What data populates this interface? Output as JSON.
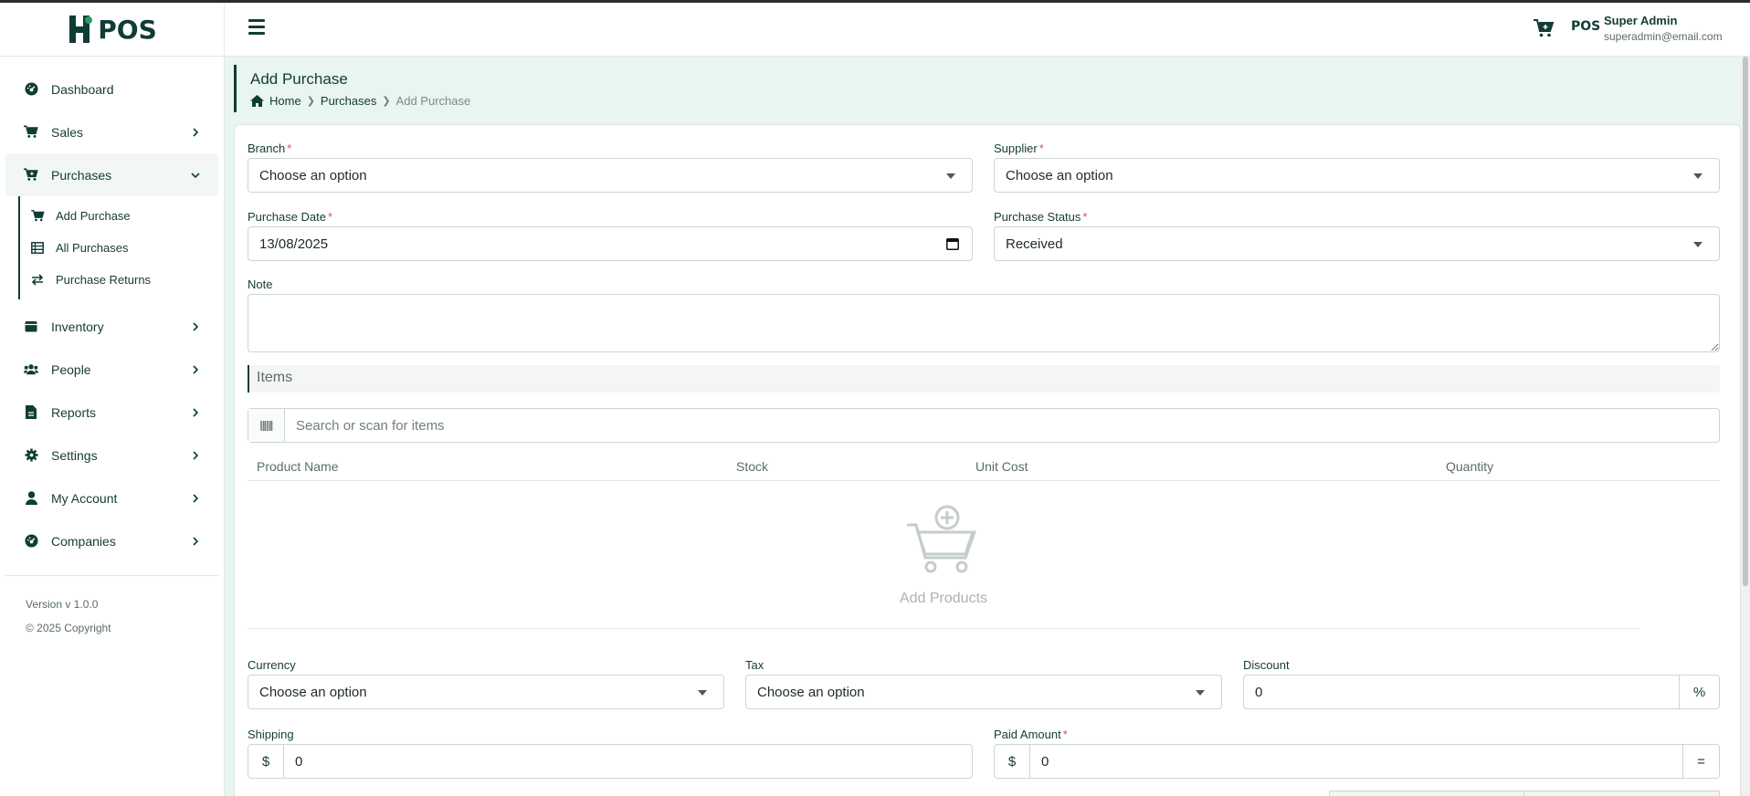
{
  "brand": {
    "logo_text": "POS",
    "mini_logo_text": "POS"
  },
  "sidebar": {
    "items": [
      {
        "label": "Dashboard"
      },
      {
        "label": "Sales"
      },
      {
        "label": "Purchases"
      },
      {
        "label": "Inventory"
      },
      {
        "label": "People"
      },
      {
        "label": "Reports"
      },
      {
        "label": "Settings"
      },
      {
        "label": "My Account"
      },
      {
        "label": "Companies"
      }
    ],
    "purchases_sub": [
      {
        "label": "Add Purchase"
      },
      {
        "label": "All Purchases"
      },
      {
        "label": "Purchase Returns"
      }
    ],
    "version": "Version v 1.0.0",
    "copyright": "© 2025 Copyright"
  },
  "header": {
    "user_name": "Super Admin",
    "user_email": "superadmin@email.com"
  },
  "page": {
    "title": "Add Purchase",
    "breadcrumb": [
      "Home",
      "Purchases",
      "Add Purchase"
    ]
  },
  "form": {
    "branch_label": "Branch",
    "branch_value": "Choose an option",
    "supplier_label": "Supplier",
    "supplier_value": "Choose an option",
    "date_label": "Purchase Date",
    "date_value": "13/08/2025",
    "status_label": "Purchase Status",
    "status_value": "Received",
    "note_label": "Note",
    "note_value": "",
    "items_title": "Items",
    "search_placeholder": "Search or scan for items",
    "columns": [
      "Product Name",
      "Stock",
      "Unit Cost",
      "Quantity"
    ],
    "empty_label": "Add Products",
    "currency_label": "Currency",
    "currency_value": "Choose an option",
    "tax_label": "Tax",
    "tax_value": "Choose an option",
    "discount_label": "Discount",
    "discount_value": "0",
    "discount_unit": "%",
    "shipping_label": "Shipping",
    "shipping_prefix": "$",
    "shipping_value": "0",
    "paid_label": "Paid Amount",
    "paid_prefix": "$",
    "paid_value": "0",
    "paid_suffix": "="
  },
  "colors": {
    "brand": "#0f3d36",
    "background": "#e9f5ef",
    "required": "#d9534f"
  }
}
